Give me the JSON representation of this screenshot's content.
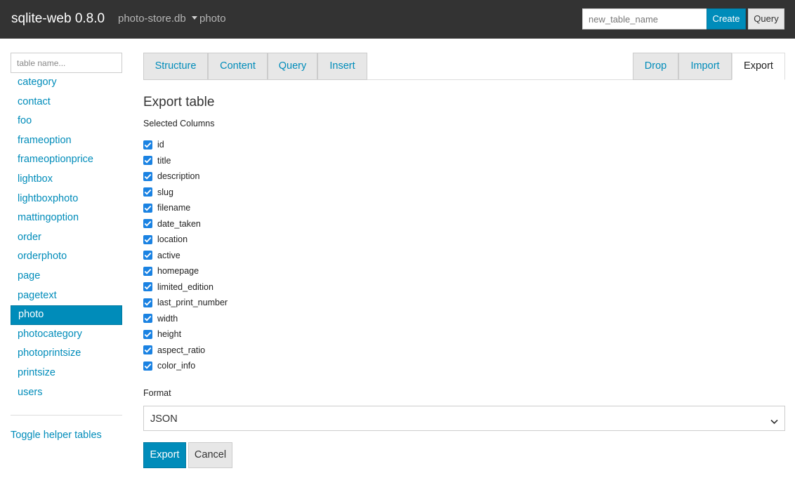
{
  "header": {
    "brand": "sqlite-web 0.8.0",
    "database": "photo-store.db",
    "table": "photo",
    "new_table_placeholder": "new_table_name",
    "create_label": "Create",
    "query_label": "Query"
  },
  "sidebar": {
    "filter_placeholder": "table name...",
    "tables": [
      "category",
      "contact",
      "foo",
      "frameoption",
      "frameoptionprice",
      "lightbox",
      "lightboxphoto",
      "mattingoption",
      "order",
      "orderphoto",
      "page",
      "pagetext",
      "photo",
      "photocategory",
      "photoprintsize",
      "printsize",
      "users"
    ],
    "active_table": "photo",
    "toggle_label": "Toggle helper tables"
  },
  "tabs": {
    "structure": "Structure",
    "content": "Content",
    "query": "Query",
    "insert": "Insert",
    "drop": "Drop",
    "import": "Import",
    "export": "Export",
    "active": "Export"
  },
  "export": {
    "title": "Export table",
    "columns_label": "Selected Columns",
    "columns": [
      {
        "name": "id",
        "checked": true
      },
      {
        "name": "title",
        "checked": true
      },
      {
        "name": "description",
        "checked": true
      },
      {
        "name": "slug",
        "checked": true
      },
      {
        "name": "filename",
        "checked": true
      },
      {
        "name": "date_taken",
        "checked": true
      },
      {
        "name": "location",
        "checked": true
      },
      {
        "name": "active",
        "checked": true
      },
      {
        "name": "homepage",
        "checked": true
      },
      {
        "name": "limited_edition",
        "checked": true
      },
      {
        "name": "last_print_number",
        "checked": true
      },
      {
        "name": "width",
        "checked": true
      },
      {
        "name": "height",
        "checked": true
      },
      {
        "name": "aspect_ratio",
        "checked": true
      },
      {
        "name": "color_info",
        "checked": true
      }
    ],
    "format_label": "Format",
    "format_value": "JSON",
    "export_label": "Export",
    "cancel_label": "Cancel"
  },
  "colors": {
    "accent": "#008cba",
    "navbar": "#333333",
    "checkbox": "#1a82e2"
  }
}
